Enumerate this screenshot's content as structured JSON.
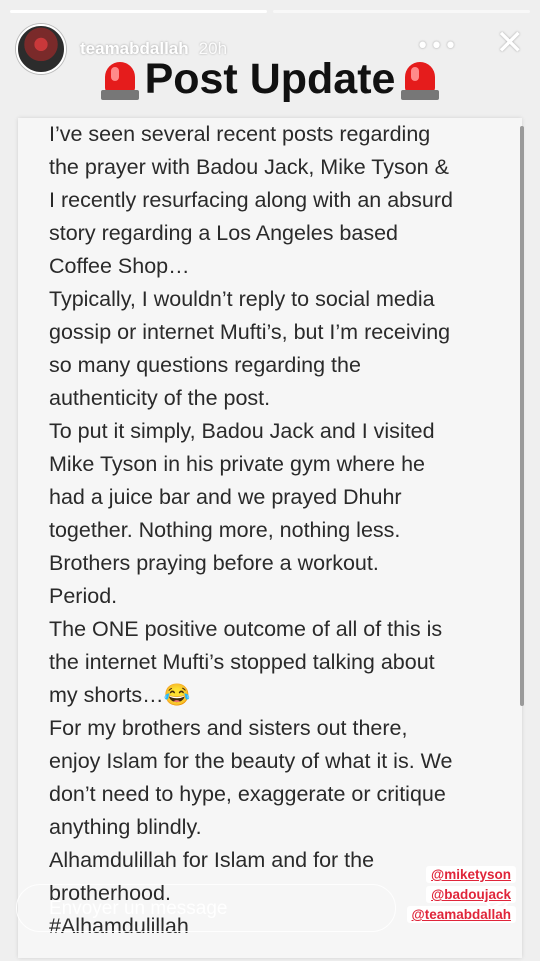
{
  "story": {
    "username": "teamabdallah",
    "time": "20h",
    "more_label": "•••",
    "close_label": "✕",
    "progress": {
      "segments": 2,
      "current": 1
    }
  },
  "post": {
    "title": "Post Update",
    "title_icon": "police-light-icon",
    "lines": [
      "I’ve seen several recent posts regarding",
      "the prayer with Badou Jack, Mike Tyson &",
      "I recently resurfacing along with an absurd",
      "story regarding a Los Angeles based",
      "Coffee Shop…",
      "Typically, I wouldn’t reply to social media",
      "gossip or internet Mufti’s, but I’m receiving",
      "so many questions regarding the",
      "authenticity of the post.",
      "To put it simply, Badou Jack and I visited",
      "Mike Tyson in his private gym where he",
      "had a juice bar and we prayed Dhuhr",
      "together.  Nothing more, nothing less.",
      "Brothers praying before a workout.",
      "Period.",
      "The ONE positive outcome of all of this is",
      "the internet Mufti’s stopped talking about",
      "my shorts…😂",
      "For my brothers and sisters out there,",
      "enjoy Islam for the beauty of what it is. We",
      "don’t need to hype, exaggerate or critique",
      "anything blindly.",
      "Alhamdulillah for Islam and for the",
      "brotherhood.",
      "#Alhamdulillah"
    ]
  },
  "composer": {
    "placeholder": "Envoyer un message"
  },
  "mentions": [
    "@miketyson",
    "@badoujack",
    "@teamabdallah"
  ],
  "colors": {
    "mention_text": "#e0253a",
    "siren_red": "#e51c1c"
  }
}
